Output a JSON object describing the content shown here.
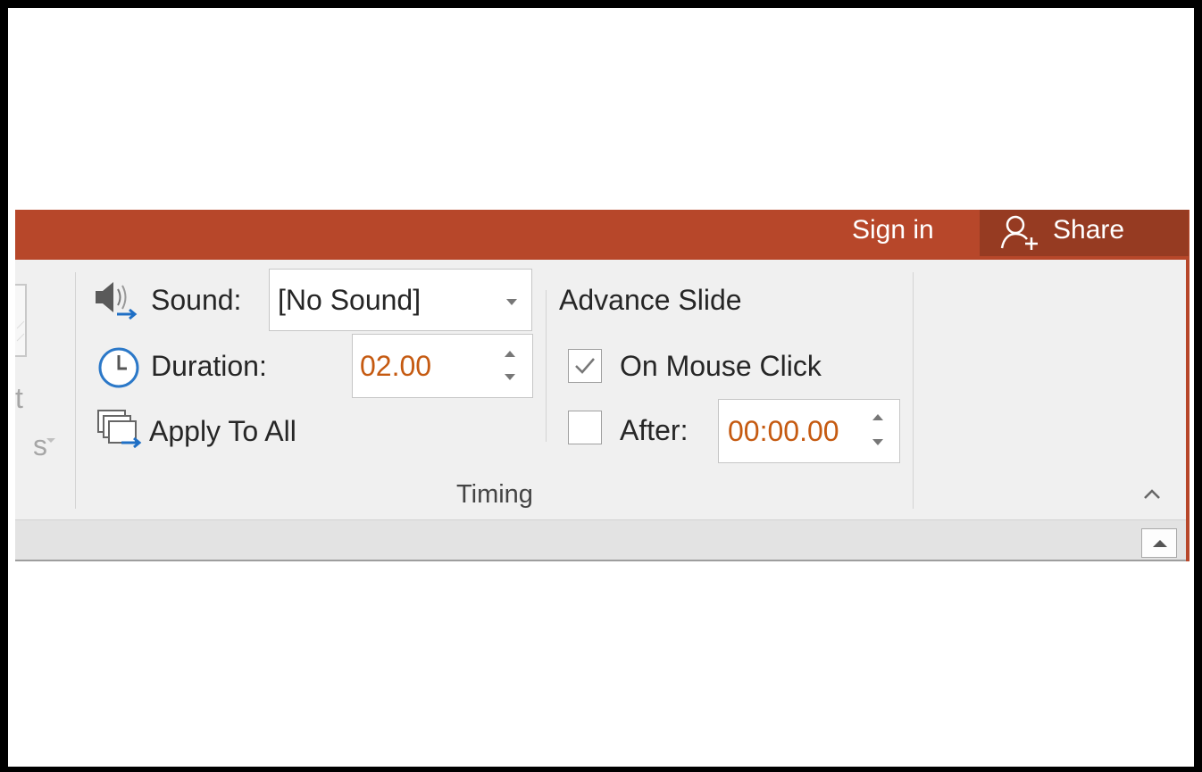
{
  "titlebar": {
    "sign_in": "Sign in",
    "share": "Share"
  },
  "ribbon": {
    "left_group": {
      "partial_label_1": "t",
      "partial_label_2": "s"
    },
    "timing": {
      "group_label": "Timing",
      "sound": {
        "label": "Sound:",
        "value": "[No Sound]"
      },
      "duration": {
        "label": "Duration:",
        "value": "02.00"
      },
      "apply_to_all": "Apply To All",
      "advance_slide": {
        "heading": "Advance Slide",
        "on_mouse_click": {
          "label": "On Mouse Click",
          "checked": true
        },
        "after": {
          "label": "After:",
          "checked": false,
          "value": "00:00.00"
        }
      }
    }
  },
  "icons": [
    "speaker-icon",
    "clock-icon",
    "apply-to-all-icon",
    "person-add-icon",
    "checkmark-icon",
    "chevron-up-icon",
    "dropdown-arrow-icon",
    "spinner-arrows-icon",
    "scroll-up-arrow-icon"
  ],
  "colors": {
    "accent": "#b7472a",
    "share_background": "#963b22",
    "value_text": "#c55a11",
    "ribbon_background": "#f0f0f0"
  }
}
